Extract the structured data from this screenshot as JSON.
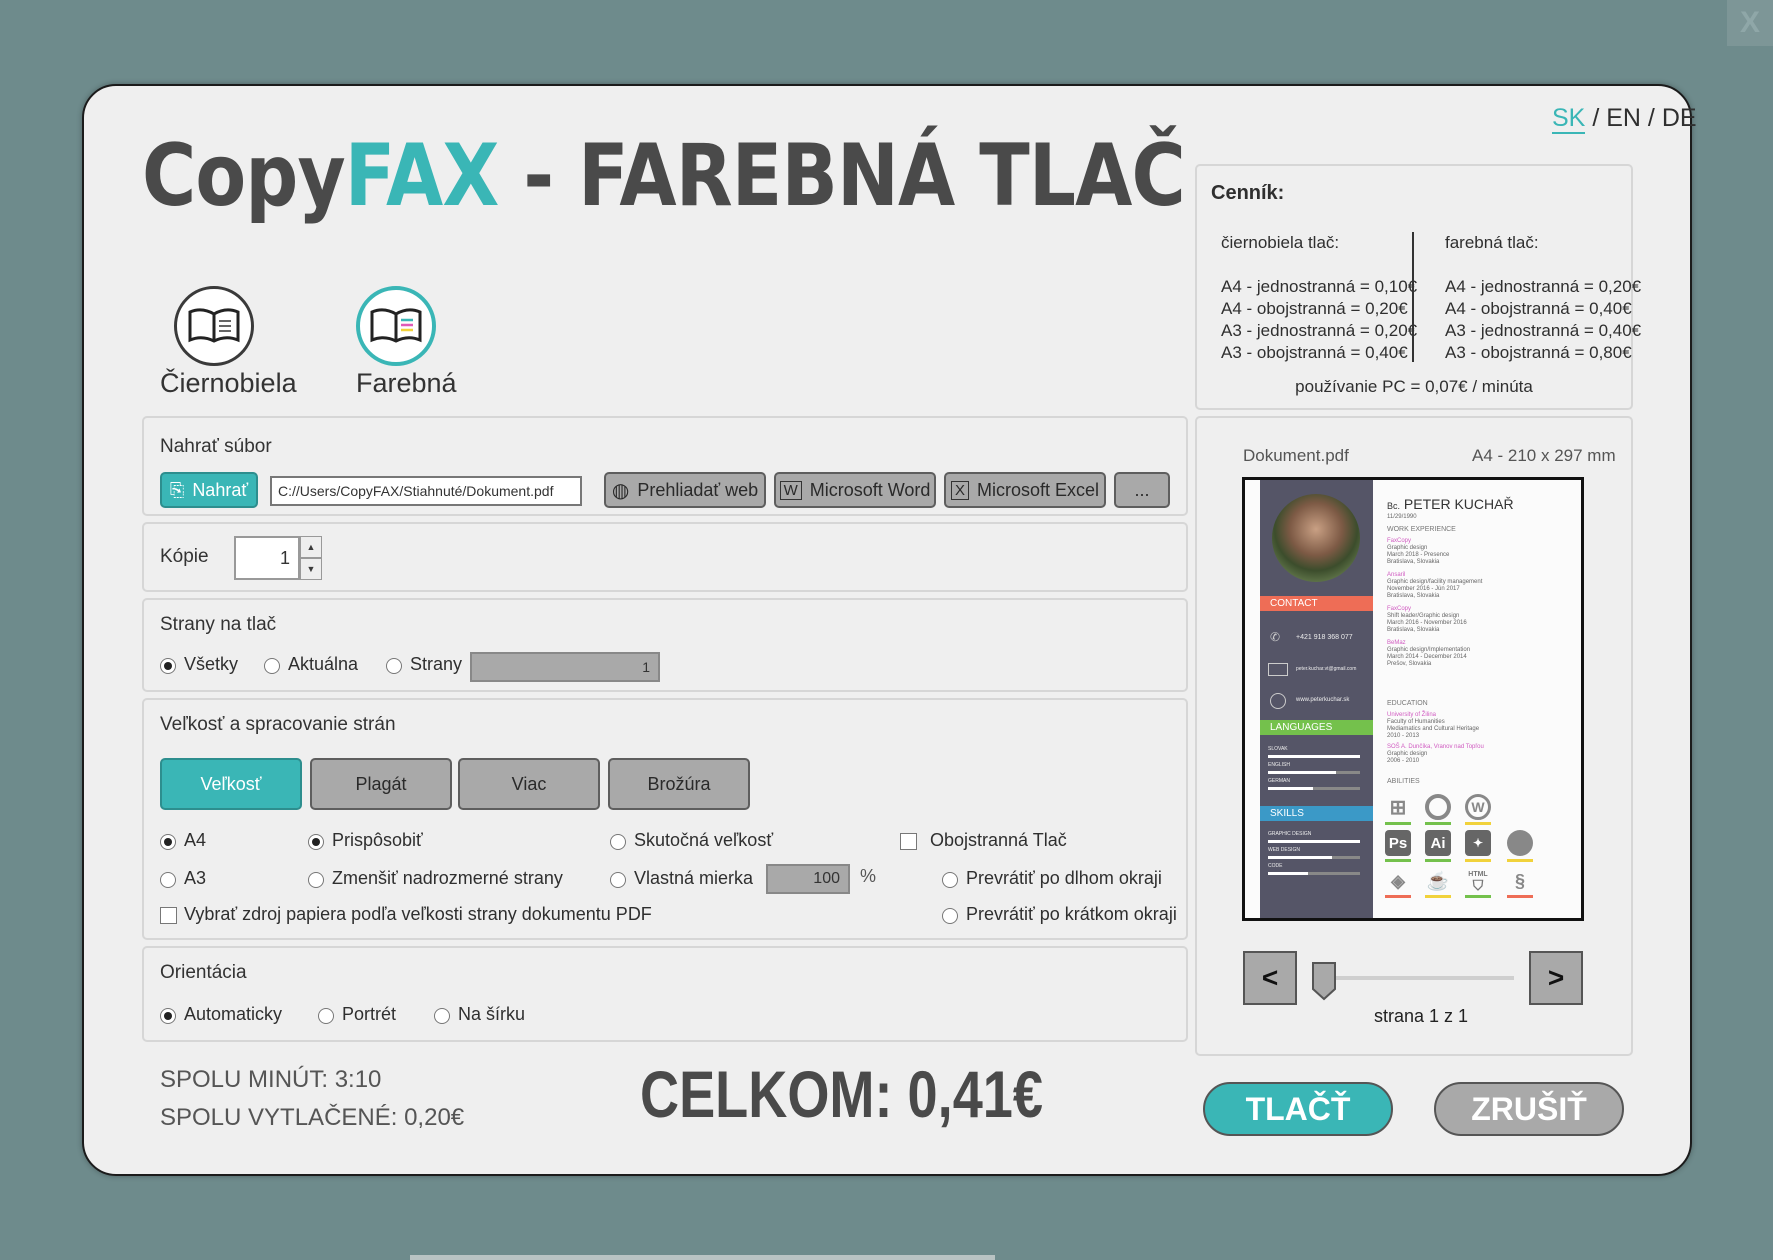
{
  "close_label": "X",
  "title": {
    "part1": "Copy",
    "part2": "FAX",
    "part3": " - FAREBNÁ TLAČ"
  },
  "languages": {
    "sk": "SK",
    "en": "EN",
    "de": "DE",
    "sep": "/"
  },
  "modes": [
    {
      "label": "Čiernobiela"
    },
    {
      "label": "Farebná"
    }
  ],
  "pricing": {
    "heading": "Cenník:",
    "bw": {
      "title": "čiernobiela tlač:",
      "items": [
        "A4 - jednostranná = 0,10€",
        "A4 - obojstranná = 0,20€",
        "A3 - jednostranná = 0,20€",
        "A3 - obojstranná = 0,40€"
      ]
    },
    "color": {
      "title": "farebná tlač:",
      "items": [
        "A4 - jednostranná = 0,20€",
        "A4 - obojstranná = 0,40€",
        "A3 - jednostranná = 0,40€",
        "A3 - obojstranná = 0,80€"
      ]
    },
    "pc": "používanie PC = 0,07€ / minúta"
  },
  "upload": {
    "label": "Nahrať súbor",
    "button": "Nahrať",
    "path": "C://Users/CopyFAX/Stiahnuté/Dokument.pdf",
    "browse": "Prehliadať web",
    "word": "Microsoft Word",
    "excel": "Microsoft Excel",
    "more": "..."
  },
  "copies": {
    "label": "Kópie",
    "value": "1"
  },
  "pages": {
    "label": "Strany na tlač",
    "all": "Všetky",
    "current": "Aktuálna",
    "range": "Strany",
    "range_value": "1"
  },
  "size": {
    "label": "Veľkosť a spracovanie strán",
    "tabs": [
      "Veľkosť",
      "Plagát",
      "Viac",
      "Brožúra"
    ],
    "a4": "A4",
    "a3": "A3",
    "fit": "Prispôsobiť",
    "shrink": "Zmenšiť nadrozmerné strany",
    "actual": "Skutočná veľkosť",
    "custom": "Vlastná mierka",
    "scale_value": "100",
    "percent": "%",
    "duplex": "Obojstranná Tlač",
    "long_edge": "Prevrátiť po dlhom okraji",
    "short_edge": "Prevrátiť po krátkom okraji",
    "pdf_source": "Vybrať zdroj papiera podľa veľkosti strany dokumentu PDF"
  },
  "orientation": {
    "label": "Orientácia",
    "auto": "Automaticky",
    "portrait": "Portrét",
    "landscape": "Na šírku"
  },
  "preview": {
    "filename": "Dokument.pdf",
    "paper": "A4 - 210 x 297 mm",
    "page_text": "strana 1 z 1",
    "slider_value": 0,
    "prev": "<",
    "next": ">",
    "cv": {
      "name_prefix": "Bc.",
      "name": "PETER KUCHAŘ",
      "dob": "11/29/1990",
      "contact": "CONTACT",
      "phone": "+421 918 368 077",
      "email": "peter.kuchar.vt@gmail.com",
      "web": "www.peterkuchar.sk",
      "languages": "LANGUAGES",
      "lang_items": [
        "SLOVAK",
        "ENGLISH",
        "GERMAN"
      ],
      "skills": "SKILLS",
      "skill_items": [
        "GRAPHIC DESIGN",
        "WEB DESIGN",
        "CODE"
      ],
      "work": "WORK EXPERIENCE",
      "education": "EDUCATION",
      "abilities": "ABILITIES",
      "work_items": [
        [
          "FaxCopy",
          "Graphic design",
          "March 2018 - Presence",
          "Bratislava, Slovakia"
        ],
        [
          "Ansaril",
          "Graphic design/facility management",
          "November 2016 - Jún 2017",
          "Bratislava, Slovakia"
        ],
        [
          "FaxCopy",
          "Shift leader/Graphic design",
          "March 2016 - November 2016",
          "Bratislava, Slovakia"
        ],
        [
          "BeMaz",
          "Graphic design/Implementation",
          "March 2014 - December 2014",
          "Prešov, Slovakia"
        ]
      ],
      "edu_items": [
        [
          "University of Žilina",
          "Faculty of Humanities",
          "Mediamatics and Cultural Heritage",
          "2010 - 2013"
        ],
        [
          "SOŠ A. Dunčíka, Vranov nad Topľou",
          "Graphic design",
          "2006 - 2010"
        ]
      ],
      "ability_labels": [
        "Ps",
        "Ai",
        "HTML"
      ]
    }
  },
  "summary": {
    "minutes": "SPOLU MINÚT: 3:10",
    "printed": "SPOLU VYTLAČENÉ: 0,20€",
    "total": "CELKOM: 0,41€"
  },
  "actions": {
    "print": "TLAČŤ",
    "cancel": "ZRUŠIŤ"
  },
  "colors": {
    "accent": "#3ab6b6",
    "background": "#6e8b8c",
    "window": "#efefef"
  }
}
